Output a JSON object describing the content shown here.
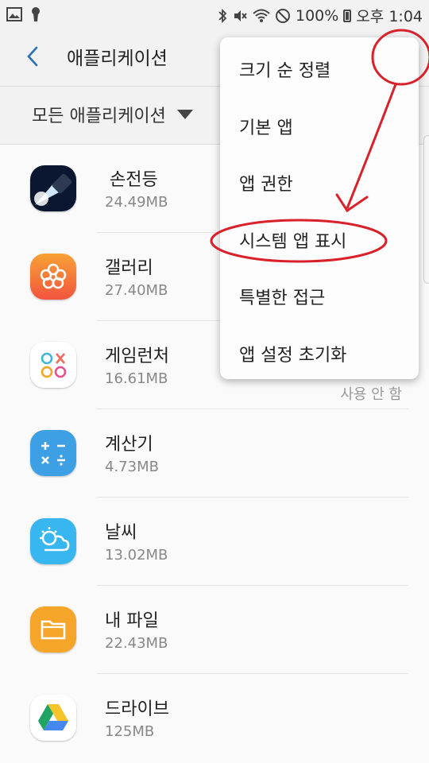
{
  "status_bar": {
    "battery": "100%",
    "time": "오후 1:04",
    "icons_left": [
      "image-icon",
      "keyhole-icon"
    ],
    "icons_right": [
      "bluetooth-icon",
      "mute-icon",
      "wifi-icon",
      "do-not-disturb-icon",
      "battery-icon"
    ]
  },
  "header": {
    "title": "애플리케이션",
    "back_icon": "back-chevron-icon"
  },
  "filter": {
    "label": "모든 애플리케이션"
  },
  "apps": [
    {
      "name": "손전등",
      "size": "24.49MB",
      "icon": "flashlight-icon"
    },
    {
      "name": "갤러리",
      "size": "27.40MB",
      "icon": "gallery-icon"
    },
    {
      "name": "게임런처",
      "size": "16.61MB",
      "icon": "game-launcher-icon",
      "extra": "사용 안 함"
    },
    {
      "name": "계산기",
      "size": "4.73MB",
      "icon": "calculator-icon"
    },
    {
      "name": "날씨",
      "size": "13.02MB",
      "icon": "weather-icon"
    },
    {
      "name": "내 파일",
      "size": "22.43MB",
      "icon": "my-files-icon"
    },
    {
      "name": "드라이브",
      "size": "125MB",
      "icon": "drive-icon"
    }
  ],
  "menu": {
    "items": [
      "크기 순 정렬",
      "기본 앱",
      "앱 권한",
      "시스템 앱 표시",
      "특별한 접근",
      "앱 설정 초기화"
    ]
  },
  "colors": {
    "accent": "#2a6fb8",
    "annotation": "#d9212b"
  }
}
